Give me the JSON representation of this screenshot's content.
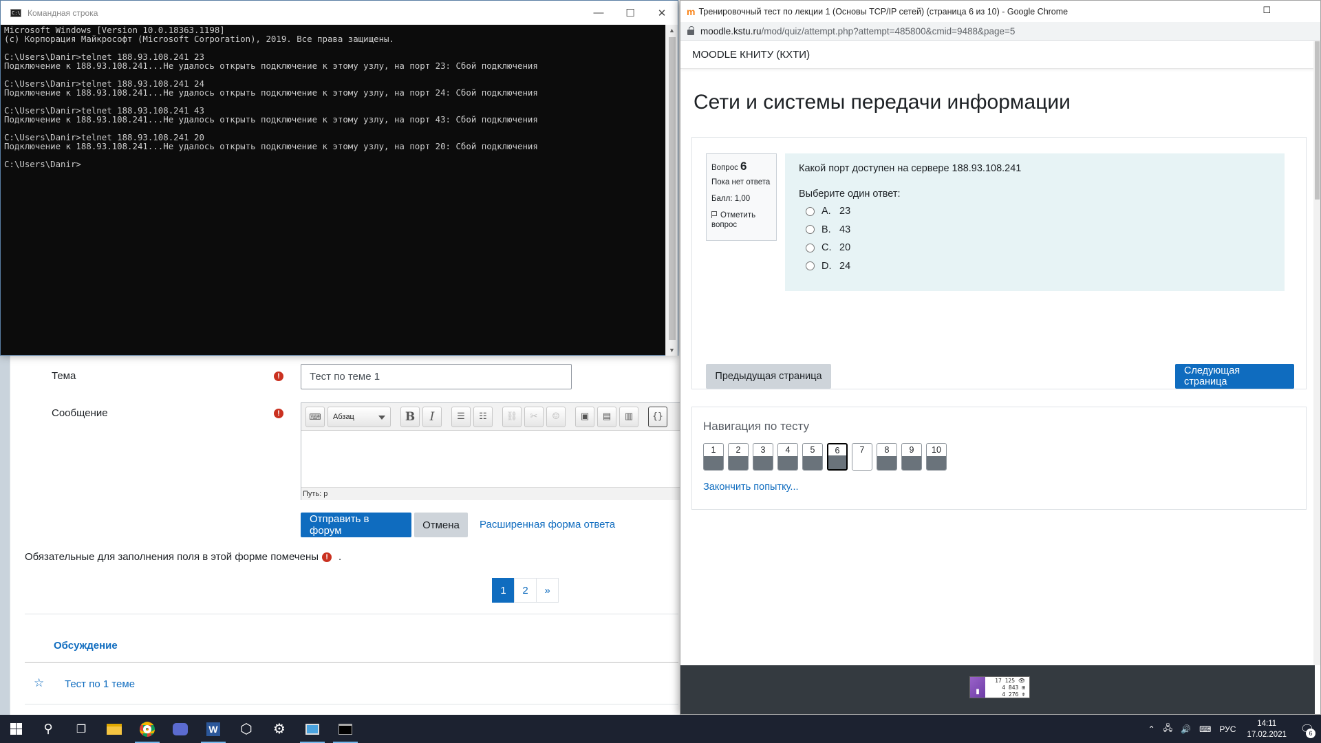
{
  "forum": {
    "subject_label": "Тема",
    "subject_value": "Тест по теме 1",
    "message_label": "Сообщение",
    "editor_format": "Абзац",
    "editor_path": "Путь: p",
    "submit_button": "Отправить в форум",
    "cancel_button": "Отмена",
    "advanced_link": "Расширенная форма ответа",
    "required_note": "Обязательные для заполнения поля в этой форме помечены",
    "required_note_end": ".",
    "required_icon": "!",
    "pages": [
      "1",
      "2",
      "»"
    ],
    "discussion_header": "Обсуждение",
    "discussion_title": "Тест по 1 теме"
  },
  "cmd": {
    "title": "Командная строка",
    "icon_text": "C:\\",
    "lines": [
      "Microsoft Windows [Version 10.0.18363.1198]",
      "(с) Корпорация Майкрософт (Microsoft Corporation), 2019. Все права защищены.",
      "",
      "C:\\Users\\Danir>telnet 188.93.108.241 23",
      "Подключение к 188.93.108.241...Не удалось открыть подключение к этому узлу, на порт 23: Сбой подключения",
      "",
      "C:\\Users\\Danir>telnet 188.93.108.241 24",
      "Подключение к 188.93.108.241...Не удалось открыть подключение к этому узлу, на порт 24: Сбой подключения",
      "",
      "C:\\Users\\Danir>telnet 188.93.108.241 43",
      "Подключение к 188.93.108.241...Не удалось открыть подключение к этому узлу, на порт 43: Сбой подключения",
      "",
      "C:\\Users\\Danir>telnet 188.93.108.241 20",
      "Подключение к 188.93.108.241...Не удалось открыть подключение к этому узлу, на порт 20: Сбой подключения",
      "",
      "C:\\Users\\Danir>"
    ]
  },
  "chrome": {
    "logo": "m",
    "title": "Тренировочный тест по лекции 1 (Основы TCP/IP сетей) (страница 6 из 10) - Google Chrome",
    "url_host": "moodle.kstu.ru",
    "url_path": "/mod/quiz/attempt.php?attempt=485800&cmid=9488&page=5",
    "site_name": "MOODLE КНИТУ (КХТИ)",
    "course_title": "Сети и системы передачи информации",
    "question": {
      "label": "Вопрос",
      "number": "6",
      "status": "Пока нет ответа",
      "mark": "Балл: 1,00",
      "flag_label": "Отметить вопрос",
      "text": "Какой порт доступен на сервере 188.93.108.241",
      "prompt": "Выберите один ответ:",
      "answers": [
        {
          "letter": "A.",
          "value": "23"
        },
        {
          "letter": "B.",
          "value": "43"
        },
        {
          "letter": "C.",
          "value": "20"
        },
        {
          "letter": "D.",
          "value": "24"
        }
      ]
    },
    "prev_button": "Предыдущая страница",
    "next_button": "Следующая страница",
    "nav_title": "Навигация по тесту",
    "nav_numbers": [
      "1",
      "2",
      "3",
      "4",
      "5",
      "6",
      "7",
      "8",
      "9",
      "10"
    ],
    "nav_current": "6",
    "finish_link": "Закончить попытку...",
    "counter_lines": [
      "17 125 👁",
      "4 843 ⊞",
      "4 276 ☤"
    ]
  },
  "taskbar": {
    "lang": "РУС",
    "time": "14:11",
    "date": "17.02.2021",
    "notifications": "6"
  }
}
